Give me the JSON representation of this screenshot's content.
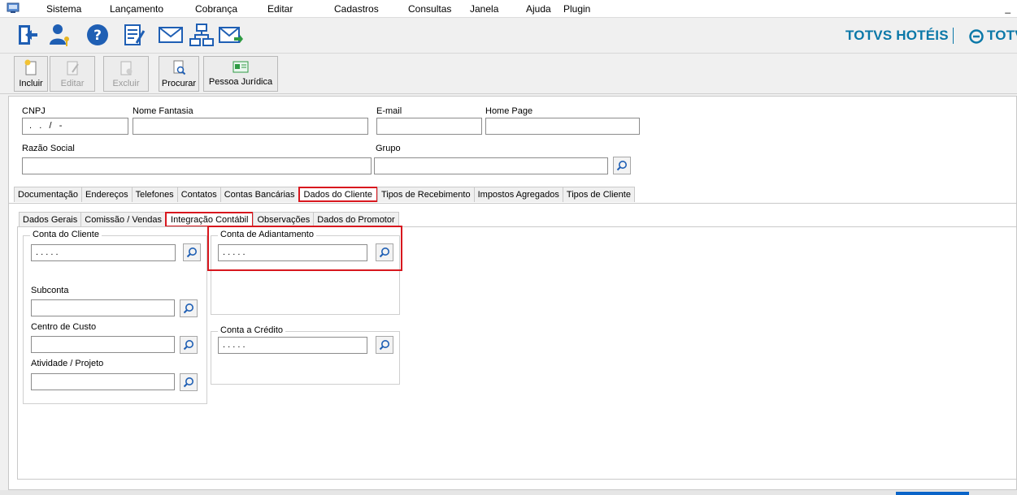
{
  "menu": [
    "Sistema",
    "Lançamento",
    "Cobrança",
    "Editar",
    "Cadastros",
    "Consultas",
    "Janela",
    "Ajuda",
    "Plugin"
  ],
  "menu_right": "_",
  "brand": {
    "left": "TOTVS HOTÉIS",
    "right": "TOTV",
    "color": "#0b78a8"
  },
  "toolbar": {
    "incluir": "Incluir",
    "editar": "Editar",
    "excluir": "Excluir",
    "procurar": "Procurar",
    "pessoa_juridica": "Pessoa Jurídica"
  },
  "form": {
    "cnpj_label": "CNPJ",
    "cnpj_value": " .   .   /   -",
    "nome_fantasia_label": "Nome Fantasia",
    "email_label": "E-mail",
    "home_page_label": "Home Page",
    "razao_social_label": "Razão Social",
    "grupo_label": "Grupo"
  },
  "tabs": [
    "Documentação",
    "Endereços",
    "Telefones",
    "Contatos",
    "Contas Bancárias",
    "Dados do Cliente",
    "Tipos de Recebimento",
    "Impostos Agregados",
    "Tipos de Cliente"
  ],
  "subtabs": [
    "Dados Gerais",
    "Comissão / Vendas",
    "Integração Contábil",
    "Observações",
    "Dados do Promotor"
  ],
  "integracao": {
    "conta_cliente_legend": "Conta do Cliente",
    "conta_cliente_value": ". . . . .",
    "subconta_label": "Subconta",
    "centro_custo_label": "Centro de Custo",
    "atividade_label": "Atividade / Projeto",
    "conta_adiantamento_legend": "Conta de Adiantamento",
    "conta_adiantamento_value": ". . . . .",
    "conta_credito_legend": "Conta a Crédito",
    "conta_credito_value": ". . . . ."
  },
  "colors": {
    "highlight": "#d8171e",
    "accent": "#0b78a8"
  }
}
